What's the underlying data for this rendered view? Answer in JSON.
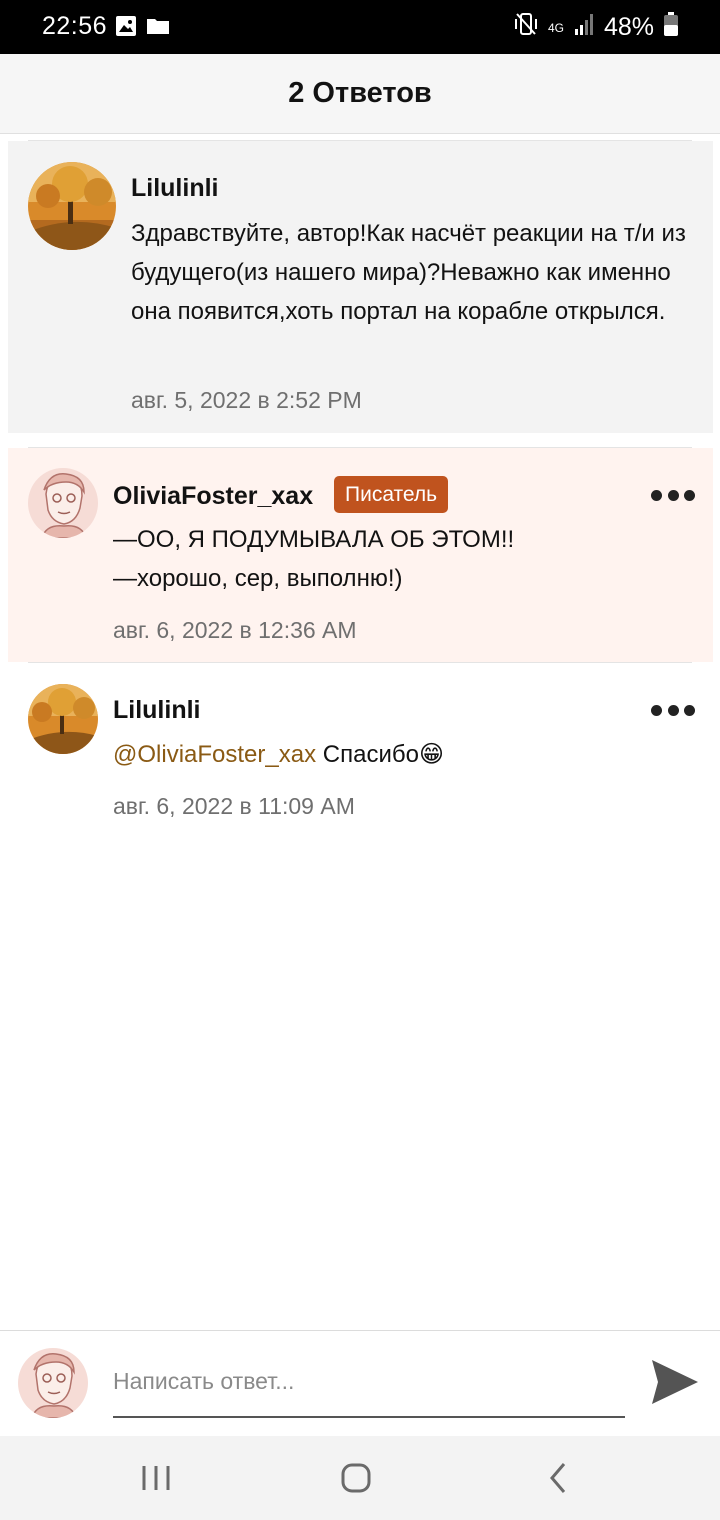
{
  "status_bar": {
    "time": "22:56",
    "battery_percent": "48%",
    "network": "4G",
    "icons": [
      "image-icon",
      "folder-icon",
      "vibrate-icon",
      "signal-icon",
      "battery-icon"
    ]
  },
  "header": {
    "title": "2 Ответов"
  },
  "comments": [
    {
      "author": "Lilulinli",
      "text": "Здравствуйте, автор!Как насчёт реакции на т/и из будущего(из нашего мира)?Неважно как именно она появится,хоть портал на корабле открылся.",
      "timestamp": "авг. 5, 2022 в 2:52 PM",
      "background": "#f3f3f3"
    },
    {
      "author": "OliviaFoster_xax",
      "badge": "Писатель",
      "line1": "—ОО, Я ПОДУМЫВАЛА ОБ ЭТОМ!!",
      "line2": "—хорошо, сер, выполню!)",
      "timestamp": "авг. 6, 2022 в 12:36 AM",
      "background": "#fff3ef"
    },
    {
      "author": "Lilulinli",
      "mention": "@OliviaFoster_xax",
      "text": " Спасибо",
      "emoji": "😁",
      "timestamp": "авг. 6, 2022 в 11:09 AM"
    }
  ],
  "reply": {
    "placeholder": "Написать ответ..."
  },
  "colors": {
    "badge": "#c0531e",
    "mention": "#8a5a14",
    "highlight": "#fff3ef"
  }
}
